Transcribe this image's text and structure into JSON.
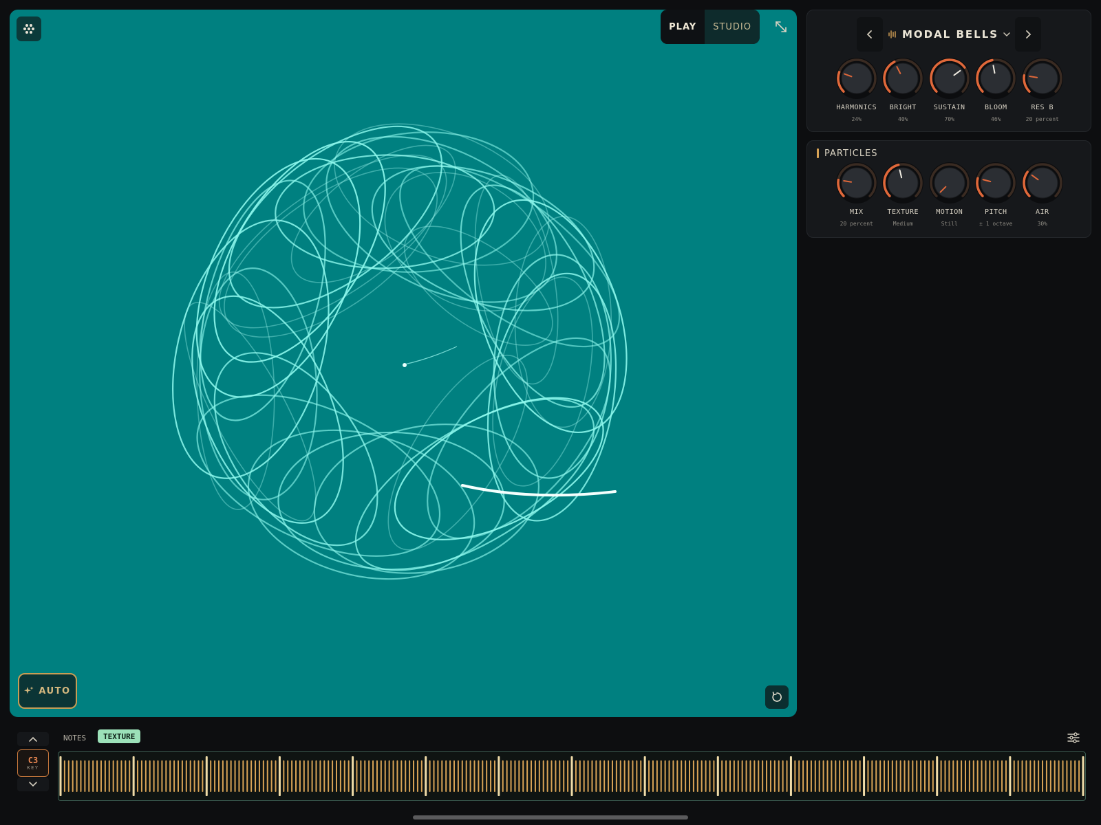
{
  "viewer": {
    "mode_tabs": [
      "PLAY",
      "STUDIO"
    ],
    "active_mode": "PLAY",
    "auto_label": "AUTO",
    "background_color": "#008080",
    "trace_color": "#8ef9ee",
    "icons": {
      "menu": "grid-dots-icon",
      "expand": "expand-arrows-icon",
      "auto": "sparkle-icon",
      "reset": "rotate-reset-icon"
    }
  },
  "preset": {
    "name": "MODAL BELLS",
    "icons": {
      "prev": "chevron-left-icon",
      "next": "chevron-right-icon",
      "type": "waveform-icon",
      "dropdown": "chevron-down-icon"
    },
    "knobs": [
      {
        "label": "HARMONICS",
        "value": "24%",
        "level": 0.24
      },
      {
        "label": "BRIGHT",
        "value": "40%",
        "level": 0.4
      },
      {
        "label": "SUSTAIN",
        "value": "70%",
        "level": 0.7
      },
      {
        "label": "BLOOM",
        "value": "46%",
        "level": 0.46
      },
      {
        "label": "RES B",
        "value": "20 percent",
        "level": 0.2
      }
    ]
  },
  "particles": {
    "title": "PARTICLES",
    "knobs": [
      {
        "label": "MIX",
        "value": "20 percent",
        "level": 0.2
      },
      {
        "label": "TEXTURE",
        "value": "Medium",
        "level": 0.45
      },
      {
        "label": "MOTION",
        "value": "Still",
        "level": 0.0
      },
      {
        "label": "PITCH",
        "value": "± 1 octave",
        "level": 0.22
      },
      {
        "label": "AIR",
        "value": "30%",
        "level": 0.3
      }
    ]
  },
  "bottom": {
    "key_note": "C3",
    "key_sub": "KEY",
    "tabs": [
      "NOTES",
      "TEXTURE"
    ],
    "active_tab": "TEXTURE",
    "accent_color": "#d8a356",
    "icons": {
      "octave_up": "chevron-up-icon",
      "octave_down": "chevron-down-icon",
      "settings": "sliders-icon"
    }
  }
}
